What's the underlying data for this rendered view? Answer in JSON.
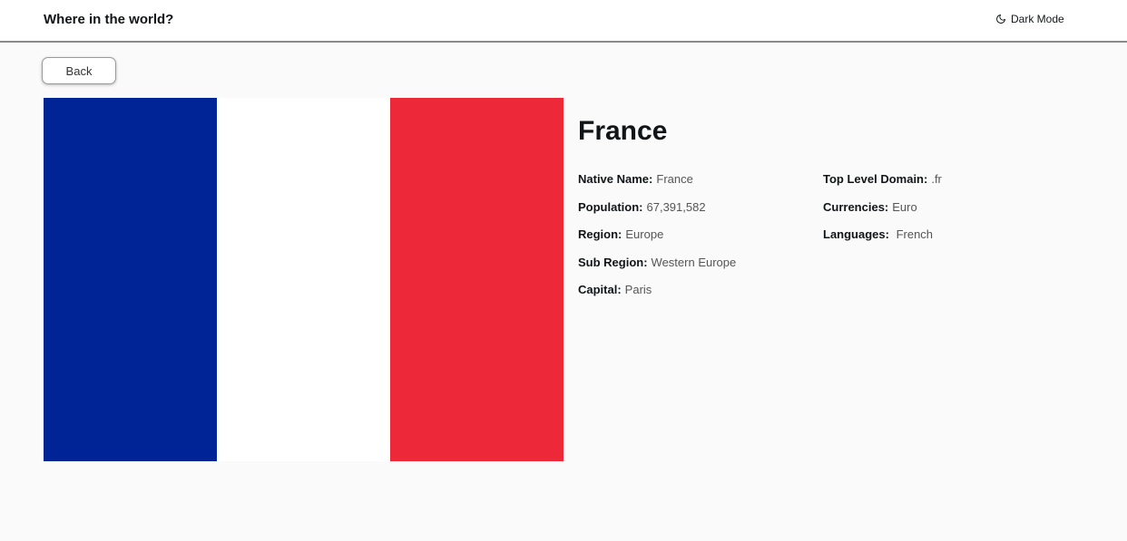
{
  "header": {
    "title": "Where in the world?",
    "theme_toggle_label": "Dark Mode",
    "theme_toggle_icon": "moon-icon"
  },
  "back_button_label": "Back",
  "country": {
    "name": "France",
    "flag": {
      "description_icon": "flag-of-france",
      "colors": [
        "#002395",
        "#ffffff",
        "#ED2939"
      ]
    },
    "details_left": [
      {
        "label": "Native Name:",
        "value": "France"
      },
      {
        "label": "Population:",
        "value": "67,391,582"
      },
      {
        "label": "Region:",
        "value": "Europe"
      },
      {
        "label": "Sub Region:",
        "value": "Western Europe"
      },
      {
        "label": "Capital:",
        "value": "Paris"
      }
    ],
    "details_right": [
      {
        "label": "Top Level Domain:",
        "value": ".fr"
      },
      {
        "label": "Currencies:",
        "value": "Euro"
      },
      {
        "label": "Languages:",
        "value": " French"
      }
    ]
  }
}
